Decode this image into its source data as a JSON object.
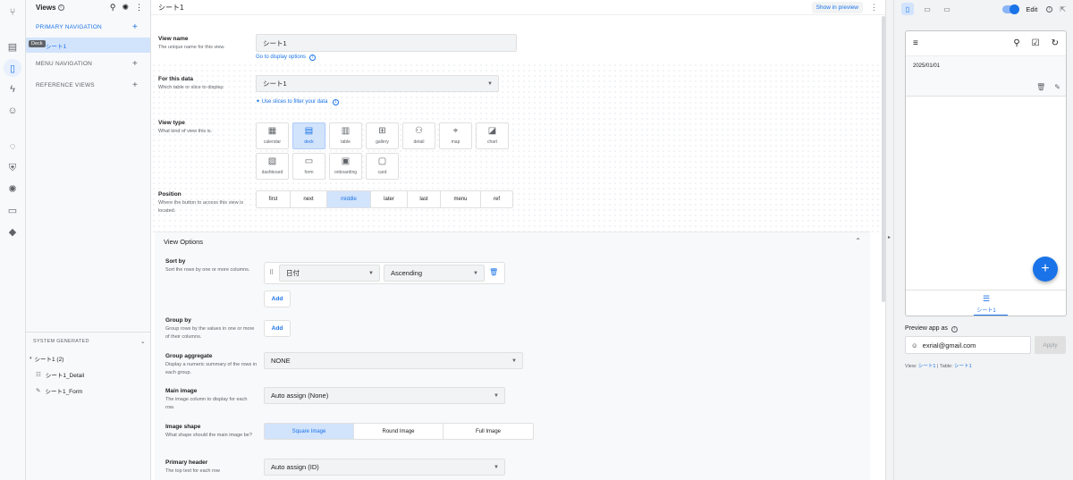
{
  "rail": {
    "icons": [
      "share-icon",
      "table-icon",
      "phone-icon",
      "bolt-icon",
      "bot-icon",
      "bulb-icon",
      "shield-icon",
      "settings-icon",
      "monitor-icon",
      "school-icon"
    ]
  },
  "views_panel": {
    "title": "Views",
    "primary_nav": "PRIMARY NAVIGATION",
    "primary_item": "シート1",
    "deck_tooltip": "Deck",
    "menu_nav": "MENU NAVIGATION",
    "reference_views": "REFERENCE VIEWS",
    "system_generated": "SYSTEM GENERATED",
    "sys_group": "シート1 (2)",
    "sys_items": [
      "シート1_Detail",
      "シート1_Form"
    ]
  },
  "editor": {
    "title": "シート1",
    "show_in_preview": "Show in preview",
    "view_name": {
      "label": "View name",
      "sub": "The unique name for this view.",
      "value": "シート1",
      "link": "Go to display options"
    },
    "for_data": {
      "label": "For this data",
      "sub": "Which table or slice to display.",
      "value": "シート1",
      "link": "Use slices to filter your data"
    },
    "view_type": {
      "label": "View type",
      "sub": "What kind of view this is.",
      "types": [
        {
          "name": "calendar",
          "glyph": "▦"
        },
        {
          "name": "deck",
          "glyph": "▤"
        },
        {
          "name": "table",
          "glyph": "▥"
        },
        {
          "name": "gallery",
          "glyph": "⊞"
        },
        {
          "name": "detail",
          "glyph": "⚇"
        },
        {
          "name": "map",
          "glyph": "⌖"
        },
        {
          "name": "chart",
          "glyph": "◪"
        },
        {
          "name": "dashboard",
          "glyph": "▧"
        },
        {
          "name": "form",
          "glyph": "▭"
        },
        {
          "name": "onboarding",
          "glyph": "▣"
        },
        {
          "name": "card",
          "glyph": "▢"
        }
      ],
      "selected": "deck"
    },
    "position": {
      "label": "Position",
      "sub": "Where the button to access this view is located.",
      "options": [
        "first",
        "next",
        "middle",
        "later",
        "last",
        "menu",
        "ref"
      ],
      "selected": "middle"
    },
    "view_options": {
      "title": "View Options",
      "sort_by": {
        "label": "Sort by",
        "sub": "Sort the rows by one or more columns.",
        "column": "日付",
        "order": "Ascending",
        "add": "Add"
      },
      "group_by": {
        "label": "Group by",
        "sub": "Group rows by the values in one or more of their columns.",
        "add": "Add"
      },
      "group_aggregate": {
        "label": "Group aggregate",
        "sub": "Display a numeric summary of the rows in each group.",
        "value": "NONE"
      },
      "main_image": {
        "label": "Main image",
        "sub": "The image column to display for each row.",
        "value": "Auto assign (None)"
      },
      "image_shape": {
        "label": "Image shape",
        "sub": "What shape should the main image be?",
        "options": [
          "Square Image",
          "Round Image",
          "Full Image"
        ],
        "selected": "Square Image"
      },
      "primary_header": {
        "label": "Primary header",
        "sub": "The top text for each row",
        "value": "Auto assign (ID)"
      }
    }
  },
  "preview": {
    "edit_label": "Edit",
    "card_date": "2025/01/01",
    "nav_label": "シート1",
    "preview_as_label": "Preview app as",
    "email": "exrial@gmail.com",
    "apply": "Apply",
    "view_label": "View:",
    "view_value": "シート1",
    "table_label": "Table:",
    "table_value": "シート1"
  },
  "colors": {
    "accent": "#1a73e8",
    "selected_bg": "#d2e3fc"
  }
}
